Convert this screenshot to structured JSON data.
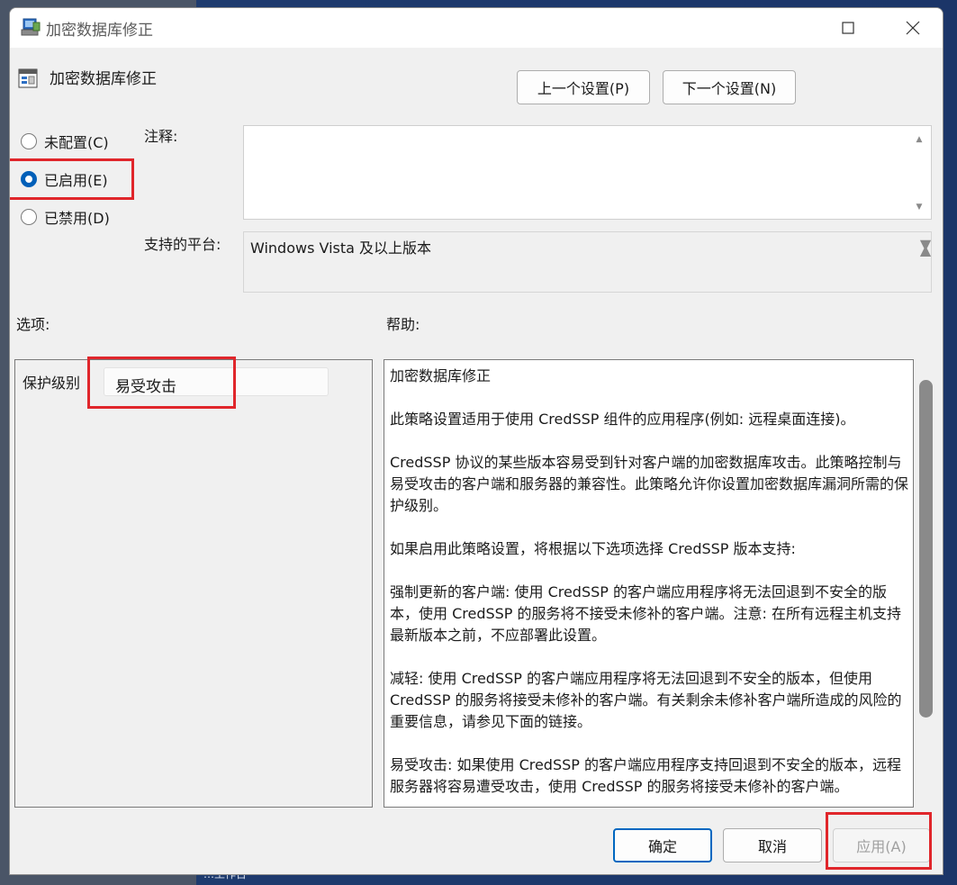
{
  "window": {
    "title": "加密数据库修正",
    "icons": {
      "title": "policy-icon",
      "minimize": "minimize-icon",
      "maximize": "maximize-icon",
      "close": "close-icon"
    }
  },
  "header": {
    "title": "加密数据库修正",
    "prev_button": "上一个设置(P)",
    "next_button": "下一个设置(N)"
  },
  "state": {
    "options": [
      {
        "label": "未配置(C)",
        "checked": false
      },
      {
        "label": "已启用(E)",
        "checked": true
      },
      {
        "label": "已禁用(D)",
        "checked": false
      }
    ]
  },
  "comment": {
    "label": "注释:",
    "value": ""
  },
  "platform": {
    "label": "支持的平台:",
    "value": "Windows Vista 及以上版本"
  },
  "options_section": {
    "label": "选项:",
    "protection_level_label": "保护级别",
    "protection_level_value": "易受攻击"
  },
  "help_section": {
    "label": "帮助:",
    "paragraphs": [
      "加密数据库修正",
      "此策略设置适用于使用 CredSSP 组件的应用程序(例如: 远程桌面连接)。",
      "CredSSP 协议的某些版本容易受到针对客户端的加密数据库攻击。此策略控制与易受攻击的客户端和服务器的兼容性。此策略允许你设置加密数据库漏洞所需的保护级别。",
      "如果启用此策略设置，将根据以下选项选择 CredSSP 版本支持:",
      "强制更新的客户端: 使用 CredSSP 的客户端应用程序将无法回退到不安全的版本，使用 CredSSP 的服务将不接受未修补的客户端。注意: 在所有远程主机支持最新版本之前，不应部署此设置。",
      "减轻: 使用 CredSSP 的客户端应用程序将无法回退到不安全的版本，但使用 CredSSP 的服务将接受未修补的客户端。有关剩余未修补客户端所造成的风险的重要信息，请参见下面的链接。",
      "易受攻击: 如果使用 CredSSP 的客户端应用程序支持回退到不安全的版本，远程服务器将容易遭受攻击，使用 CredSSP 的服务将接受未修补的客户端。"
    ]
  },
  "footer": {
    "ok": "确定",
    "cancel": "取消",
    "apply": "应用(A)"
  },
  "background": {
    "taskbar_text": "…工作台"
  },
  "colors": {
    "accent": "#005fb8",
    "highlight_box": "#e0262b"
  }
}
